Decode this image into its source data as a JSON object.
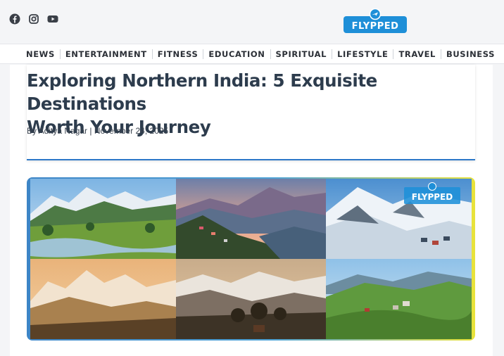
{
  "social": {
    "icons": [
      "facebook-icon",
      "instagram-icon",
      "youtube-icon"
    ]
  },
  "brand": {
    "logo_text": "FLYPPED",
    "color": "#1e8fd8"
  },
  "nav": {
    "items": [
      "NEWS",
      "ENTERTAINMENT",
      "FITNESS",
      "EDUCATION",
      "SPIRITUAL",
      "LIFESTYLE",
      "TRAVEL",
      "BUSINESS"
    ]
  },
  "article": {
    "title_line1": "Exploring Northern India: 5 Exquisite Destinations",
    "title_line2": "Worth Your Journey",
    "byline": "By Aditya Nagar | November 24, 2025",
    "accent_color": "#2d78c8"
  },
  "hero": {
    "watermark_text": "FLYPPED",
    "tiles": [
      "river-valley",
      "sunset-ridge",
      "snow-village",
      "golden-peaks",
      "forest-dusk",
      "green-hills"
    ]
  }
}
